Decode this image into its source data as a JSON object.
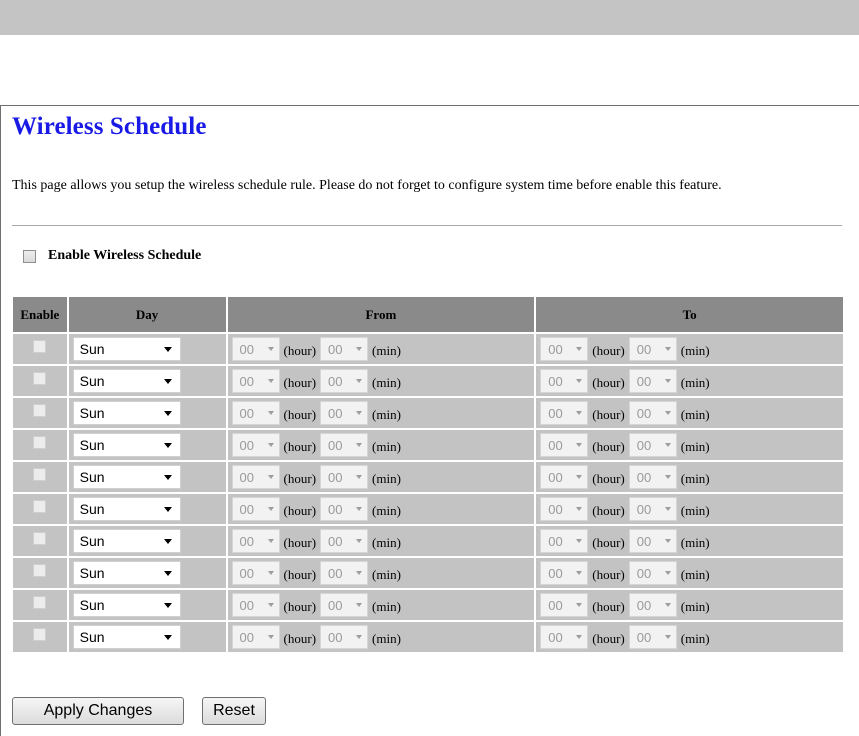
{
  "page": {
    "title": "Wireless Schedule",
    "description": "This page allows you setup the wireless schedule rule. Please do not forget to configure system time before enable this feature.",
    "enable_label": "Enable Wireless Schedule",
    "enable_checked": false
  },
  "table": {
    "headers": {
      "enable": "Enable",
      "day": "Day",
      "from": "From",
      "to": "To"
    },
    "hour_unit": "(hour)",
    "min_unit": "(min)",
    "rows": [
      {
        "enabled": false,
        "day": "Sun",
        "from_hour": "00",
        "from_min": "00",
        "to_hour": "00",
        "to_min": "00"
      },
      {
        "enabled": false,
        "day": "Sun",
        "from_hour": "00",
        "from_min": "00",
        "to_hour": "00",
        "to_min": "00"
      },
      {
        "enabled": false,
        "day": "Sun",
        "from_hour": "00",
        "from_min": "00",
        "to_hour": "00",
        "to_min": "00"
      },
      {
        "enabled": false,
        "day": "Sun",
        "from_hour": "00",
        "from_min": "00",
        "to_hour": "00",
        "to_min": "00"
      },
      {
        "enabled": false,
        "day": "Sun",
        "from_hour": "00",
        "from_min": "00",
        "to_hour": "00",
        "to_min": "00"
      },
      {
        "enabled": false,
        "day": "Sun",
        "from_hour": "00",
        "from_min": "00",
        "to_hour": "00",
        "to_min": "00"
      },
      {
        "enabled": false,
        "day": "Sun",
        "from_hour": "00",
        "from_min": "00",
        "to_hour": "00",
        "to_min": "00"
      },
      {
        "enabled": false,
        "day": "Sun",
        "from_hour": "00",
        "from_min": "00",
        "to_hour": "00",
        "to_min": "00"
      },
      {
        "enabled": false,
        "day": "Sun",
        "from_hour": "00",
        "from_min": "00",
        "to_hour": "00",
        "to_min": "00"
      },
      {
        "enabled": false,
        "day": "Sun",
        "from_hour": "00",
        "from_min": "00",
        "to_hour": "00",
        "to_min": "00"
      }
    ]
  },
  "buttons": {
    "apply": "Apply Changes",
    "reset": "Reset"
  },
  "colors": {
    "title": "#1a1ae6",
    "header_bg": "#8a8a8a",
    "cell_bg": "#c3c3c3",
    "top_bar": "#c4c4c4"
  }
}
